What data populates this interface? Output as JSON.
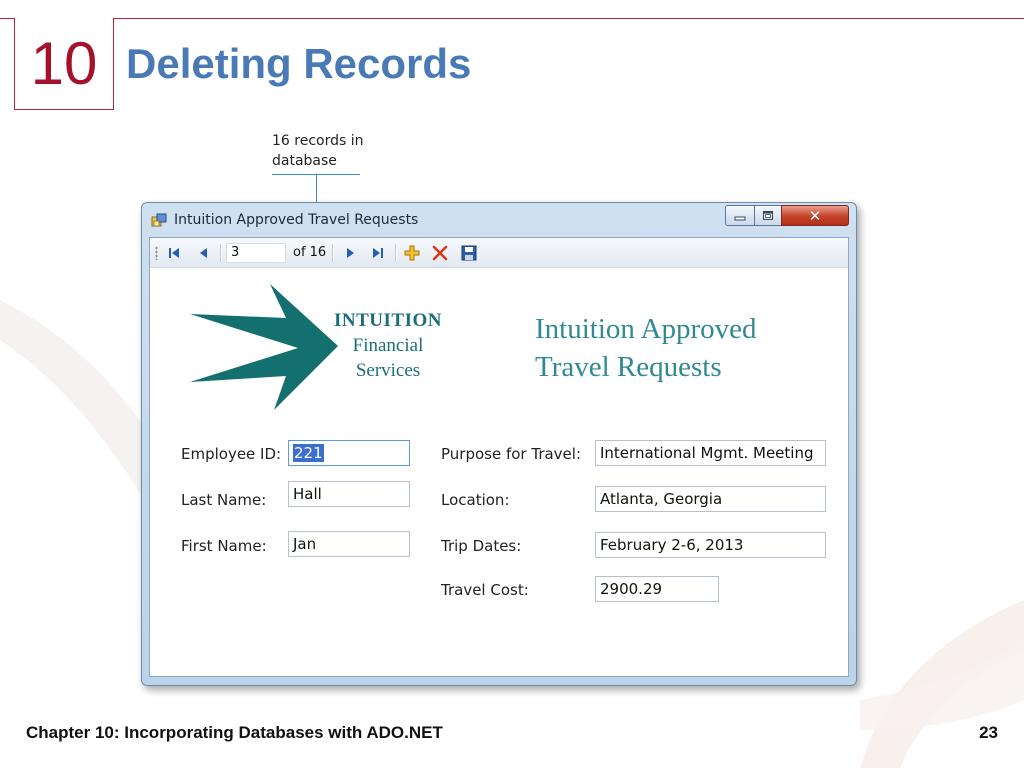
{
  "slide": {
    "chapter_number": "10",
    "title": "Deleting Records",
    "footer_text": "Chapter 10: Incorporating Databases with ADO.NET",
    "page_number": "23",
    "accent_color": "#b5283f",
    "title_color": "#4a7ab5"
  },
  "callout": {
    "line1": "16 records in",
    "line2": "database"
  },
  "window": {
    "title": "Intuition Approved Travel Requests",
    "icon": "form-app-icon",
    "controls": [
      "minimize-icon",
      "maximize-icon",
      "close-icon"
    ]
  },
  "toolbar": {
    "position_value": "3",
    "count_label": "of 16",
    "buttons": [
      "move-first-icon",
      "move-previous-icon",
      "move-next-icon",
      "move-last-icon",
      "add-new-icon",
      "delete-icon",
      "save-icon"
    ]
  },
  "logo": {
    "line1": "INTUITION",
    "line2": "Financial",
    "line3": "Services",
    "color": "#1b6e79"
  },
  "heading": {
    "line1": "Intuition Approved",
    "line2": "Travel Requests"
  },
  "form": {
    "employee_id_label": "Employee ID:",
    "employee_id_value": "221",
    "last_name_label": "Last Name:",
    "last_name_value": "Hall",
    "first_name_label": "First Name:",
    "first_name_value": "Jan",
    "purpose_label": "Purpose for Travel:",
    "purpose_value": "International Mgmt. Meeting",
    "location_label": "Location:",
    "location_value": "Atlanta, Georgia",
    "trip_dates_label": "Trip Dates:",
    "trip_dates_value": "February 2-6, 2013",
    "travel_cost_label": "Travel Cost:",
    "travel_cost_value": "2900.29"
  }
}
